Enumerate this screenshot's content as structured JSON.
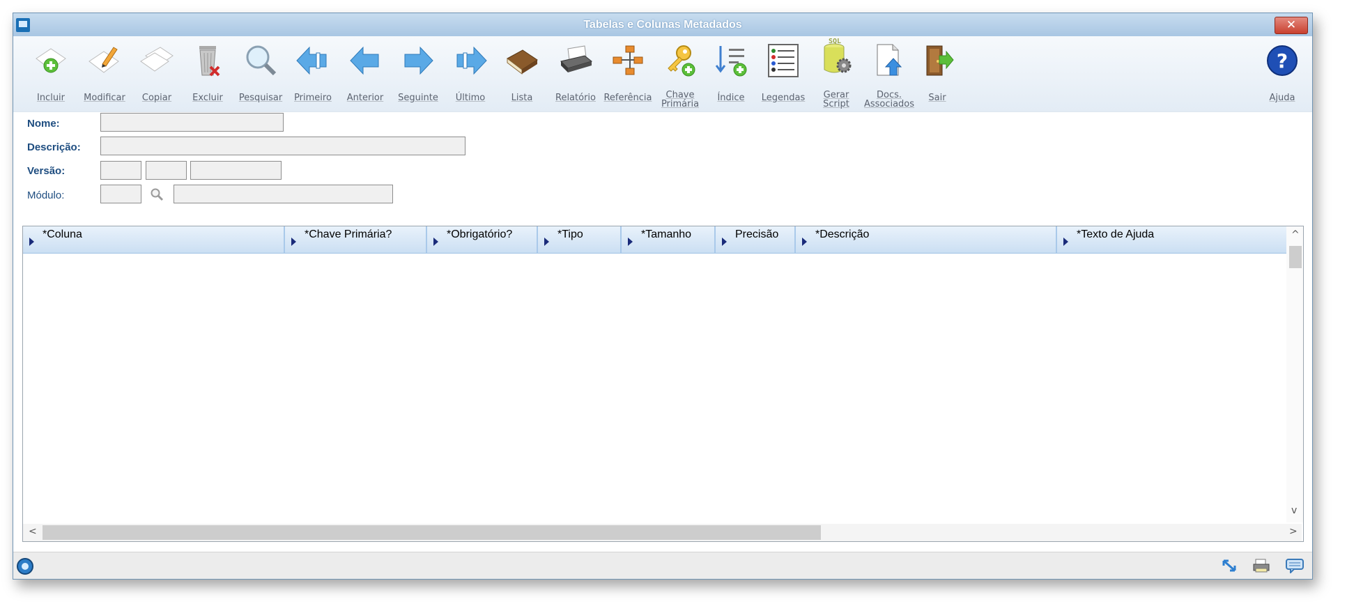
{
  "window": {
    "title": "Tabelas e Colunas Metadados",
    "close_label": "✕"
  },
  "toolbar": {
    "items": [
      {
        "label": "Incluir",
        "icon": "add-document-icon"
      },
      {
        "label": "Modificar",
        "icon": "edit-document-icon"
      },
      {
        "label": "Copiar",
        "icon": "copy-document-icon"
      },
      {
        "label": "Excluir",
        "icon": "trash-icon"
      },
      {
        "label": "Pesquisar",
        "icon": "magnifier-icon"
      },
      {
        "label": "Primeiro",
        "icon": "first-arrow-icon"
      },
      {
        "label": "Anterior",
        "icon": "previous-arrow-icon"
      },
      {
        "label": "Seguinte",
        "icon": "next-arrow-icon"
      },
      {
        "label": "Último",
        "icon": "last-arrow-icon"
      },
      {
        "label": "Lista",
        "icon": "book-icon"
      },
      {
        "label": "Relatório",
        "icon": "printer-icon"
      },
      {
        "label": "Referência",
        "icon": "hierarchy-icon"
      },
      {
        "label": "Chave Primária",
        "icon": "key-icon"
      },
      {
        "label": "Índice",
        "icon": "index-icon"
      },
      {
        "label": "Legendas",
        "icon": "legend-list-icon"
      },
      {
        "label": "Gerar Script",
        "icon": "sql-script-icon"
      },
      {
        "label": "Docs. Associados",
        "icon": "upload-document-icon"
      },
      {
        "label": "Sair",
        "icon": "exit-door-icon"
      }
    ],
    "help_label": "Ajuda"
  },
  "form": {
    "nome_label": "Nome:",
    "descricao_label": "Descrição:",
    "versao_label": "Versão:",
    "modulo_label": "Módulo:"
  },
  "grid": {
    "columns": [
      "*Coluna",
      "*Chave Primária?",
      "*Obrigatório?",
      "*Tipo",
      "*Tamanho",
      "Precisão",
      "*Descrição",
      "*Texto de Ajuda"
    ],
    "scroll_up": "^",
    "scroll_down": "v",
    "scroll_left": "<",
    "scroll_right": ">"
  },
  "colors": {
    "title_bar": "#a9c6e3",
    "label_blue": "#1e4d80",
    "close_red": "#c9402f"
  }
}
